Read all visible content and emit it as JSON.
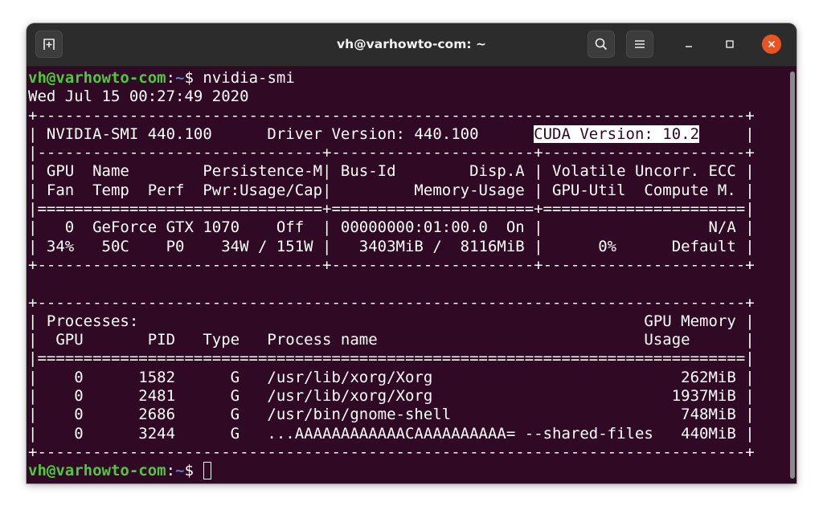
{
  "window": {
    "title": "vh@varhowto-com: ~"
  },
  "titlebar_icons": {
    "new_tab": "new-tab-icon",
    "search": "search-icon",
    "menu": "hamburger-menu-icon",
    "minimize": "minimize-icon",
    "maximize": "maximize-icon",
    "close": "close-icon"
  },
  "prompt": {
    "user_host": "vh@varhowto-com",
    "colon": ":",
    "path": "~",
    "symbol": "$ "
  },
  "command": "nvidia-smi",
  "date_line": "Wed Jul 15 00:27:49 2020",
  "smi": {
    "border_top": "+-----------------------------------------------------------------------------+",
    "header_pre": "| NVIDIA-SMI 440.100      Driver Version: 440.100      ",
    "cuda_version": "CUDA Version: 10.2",
    "header_post": "     |",
    "sep_dash": "|-------------------------------+----------------------+----------------------+",
    "col_head_1": "| GPU  Name        Persistence-M| Bus-Id        Disp.A | Volatile Uncorr. ECC |",
    "col_head_2": "| Fan  Temp  Perf  Pwr:Usage/Cap|         Memory-Usage | GPU-Util  Compute M. |",
    "sep_eq": "|===============================+======================+======================|",
    "gpu_row_1": "|   0  GeForce GTX 1070    Off  | 00000000:01:00.0  On |                  N/A |",
    "gpu_row_2": "| 34%   50C    P0    34W / 151W |   3403MiB /  8116MiB |      0%      Default |",
    "border_mid": "+-------------------------------+----------------------+----------------------+",
    "blank": " ",
    "proc_border_top": "+-----------------------------------------------------------------------------+",
    "proc_head_1": "| Processes:                                                       GPU Memory |",
    "proc_head_2": "|  GPU       PID   Type   Process name                             Usage      |",
    "proc_sep": "|=============================================================================|",
    "processes": [
      "|    0      1582      G   /usr/lib/xorg/Xorg                           262MiB |",
      "|    0      2481      G   /usr/lib/xorg/Xorg                          1937MiB |",
      "|    0      2686      G   /usr/bin/gnome-shell                         748MiB |",
      "|    0      3244      G   ...AAAAAAAAAAAACAAAAAAAAAA= --shared-files   440MiB |"
    ],
    "proc_border_bottom": "+-----------------------------------------------------------------------------+"
  }
}
